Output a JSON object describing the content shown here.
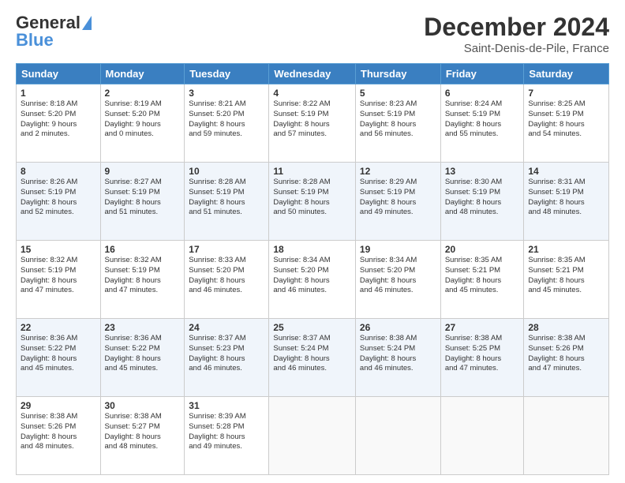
{
  "header": {
    "logo_line1": "General",
    "logo_line2": "Blue",
    "month": "December 2024",
    "location": "Saint-Denis-de-Pile, France"
  },
  "weekdays": [
    "Sunday",
    "Monday",
    "Tuesday",
    "Wednesday",
    "Thursday",
    "Friday",
    "Saturday"
  ],
  "weeks": [
    [
      {
        "day": "1",
        "text": "Sunrise: 8:18 AM\nSunset: 5:20 PM\nDaylight: 9 hours\nand 2 minutes."
      },
      {
        "day": "2",
        "text": "Sunrise: 8:19 AM\nSunset: 5:20 PM\nDaylight: 9 hours\nand 0 minutes."
      },
      {
        "day": "3",
        "text": "Sunrise: 8:21 AM\nSunset: 5:20 PM\nDaylight: 8 hours\nand 59 minutes."
      },
      {
        "day": "4",
        "text": "Sunrise: 8:22 AM\nSunset: 5:19 PM\nDaylight: 8 hours\nand 57 minutes."
      },
      {
        "day": "5",
        "text": "Sunrise: 8:23 AM\nSunset: 5:19 PM\nDaylight: 8 hours\nand 56 minutes."
      },
      {
        "day": "6",
        "text": "Sunrise: 8:24 AM\nSunset: 5:19 PM\nDaylight: 8 hours\nand 55 minutes."
      },
      {
        "day": "7",
        "text": "Sunrise: 8:25 AM\nSunset: 5:19 PM\nDaylight: 8 hours\nand 54 minutes."
      }
    ],
    [
      {
        "day": "8",
        "text": "Sunrise: 8:26 AM\nSunset: 5:19 PM\nDaylight: 8 hours\nand 52 minutes."
      },
      {
        "day": "9",
        "text": "Sunrise: 8:27 AM\nSunset: 5:19 PM\nDaylight: 8 hours\nand 51 minutes."
      },
      {
        "day": "10",
        "text": "Sunrise: 8:28 AM\nSunset: 5:19 PM\nDaylight: 8 hours\nand 51 minutes."
      },
      {
        "day": "11",
        "text": "Sunrise: 8:28 AM\nSunset: 5:19 PM\nDaylight: 8 hours\nand 50 minutes."
      },
      {
        "day": "12",
        "text": "Sunrise: 8:29 AM\nSunset: 5:19 PM\nDaylight: 8 hours\nand 49 minutes."
      },
      {
        "day": "13",
        "text": "Sunrise: 8:30 AM\nSunset: 5:19 PM\nDaylight: 8 hours\nand 48 minutes."
      },
      {
        "day": "14",
        "text": "Sunrise: 8:31 AM\nSunset: 5:19 PM\nDaylight: 8 hours\nand 48 minutes."
      }
    ],
    [
      {
        "day": "15",
        "text": "Sunrise: 8:32 AM\nSunset: 5:19 PM\nDaylight: 8 hours\nand 47 minutes."
      },
      {
        "day": "16",
        "text": "Sunrise: 8:32 AM\nSunset: 5:19 PM\nDaylight: 8 hours\nand 47 minutes."
      },
      {
        "day": "17",
        "text": "Sunrise: 8:33 AM\nSunset: 5:20 PM\nDaylight: 8 hours\nand 46 minutes."
      },
      {
        "day": "18",
        "text": "Sunrise: 8:34 AM\nSunset: 5:20 PM\nDaylight: 8 hours\nand 46 minutes."
      },
      {
        "day": "19",
        "text": "Sunrise: 8:34 AM\nSunset: 5:20 PM\nDaylight: 8 hours\nand 46 minutes."
      },
      {
        "day": "20",
        "text": "Sunrise: 8:35 AM\nSunset: 5:21 PM\nDaylight: 8 hours\nand 45 minutes."
      },
      {
        "day": "21",
        "text": "Sunrise: 8:35 AM\nSunset: 5:21 PM\nDaylight: 8 hours\nand 45 minutes."
      }
    ],
    [
      {
        "day": "22",
        "text": "Sunrise: 8:36 AM\nSunset: 5:22 PM\nDaylight: 8 hours\nand 45 minutes."
      },
      {
        "day": "23",
        "text": "Sunrise: 8:36 AM\nSunset: 5:22 PM\nDaylight: 8 hours\nand 45 minutes."
      },
      {
        "day": "24",
        "text": "Sunrise: 8:37 AM\nSunset: 5:23 PM\nDaylight: 8 hours\nand 46 minutes."
      },
      {
        "day": "25",
        "text": "Sunrise: 8:37 AM\nSunset: 5:24 PM\nDaylight: 8 hours\nand 46 minutes."
      },
      {
        "day": "26",
        "text": "Sunrise: 8:38 AM\nSunset: 5:24 PM\nDaylight: 8 hours\nand 46 minutes."
      },
      {
        "day": "27",
        "text": "Sunrise: 8:38 AM\nSunset: 5:25 PM\nDaylight: 8 hours\nand 47 minutes."
      },
      {
        "day": "28",
        "text": "Sunrise: 8:38 AM\nSunset: 5:26 PM\nDaylight: 8 hours\nand 47 minutes."
      }
    ],
    [
      {
        "day": "29",
        "text": "Sunrise: 8:38 AM\nSunset: 5:26 PM\nDaylight: 8 hours\nand 48 minutes."
      },
      {
        "day": "30",
        "text": "Sunrise: 8:38 AM\nSunset: 5:27 PM\nDaylight: 8 hours\nand 48 minutes."
      },
      {
        "day": "31",
        "text": "Sunrise: 8:39 AM\nSunset: 5:28 PM\nDaylight: 8 hours\nand 49 minutes."
      },
      null,
      null,
      null,
      null
    ]
  ]
}
